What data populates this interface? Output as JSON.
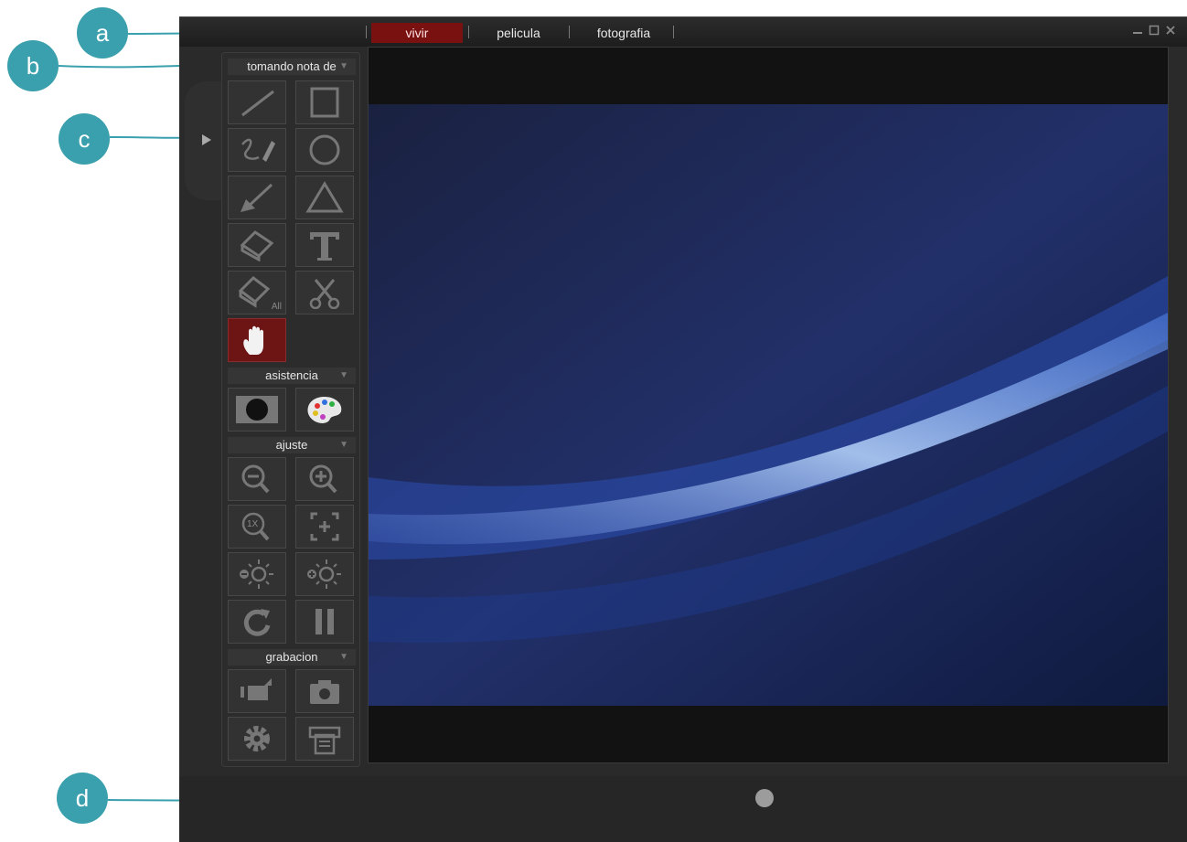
{
  "callouts": {
    "a": "a",
    "b": "b",
    "c": "c",
    "d": "d"
  },
  "tabs": [
    {
      "label": "vivir",
      "active": true
    },
    {
      "label": "pelicula",
      "active": false
    },
    {
      "label": "fotografia",
      "active": false
    }
  ],
  "window_controls": [
    "minimize-icon",
    "maximize-icon",
    "close-icon"
  ],
  "sections": {
    "annotation": {
      "label": "tomando nota de"
    },
    "assist": {
      "label": "asistencia"
    },
    "adjust": {
      "label": "ajuste"
    },
    "recording": {
      "label": "grabacion"
    }
  },
  "tools": {
    "annotation": [
      "line-icon",
      "rectangle-icon",
      "freehand-pen-icon",
      "circle-icon",
      "arrow-icon",
      "triangle-icon",
      "eraser-icon",
      "text-icon",
      "eraser-all-icon",
      "scissors-icon",
      "hand-icon"
    ],
    "eraser_all_sublabel": "All",
    "assist": [
      "spotlight-icon",
      "palette-icon"
    ],
    "adjust": [
      "zoom-out-icon",
      "zoom-in-icon",
      "zoom-1x-icon",
      "fit-screen-icon",
      "brightness-down-icon",
      "brightness-up-icon",
      "rotate-icon",
      "pause-icon"
    ],
    "zoom_1x_label": "1X",
    "recording": [
      "video-record-icon",
      "camera-icon",
      "settings-gear-icon",
      "print-icon"
    ]
  },
  "colors": {
    "active_tab": "#7a1111",
    "active_tool": "#6d1414",
    "callout": "#3aa0ad",
    "frame": "#2a2a2a"
  }
}
